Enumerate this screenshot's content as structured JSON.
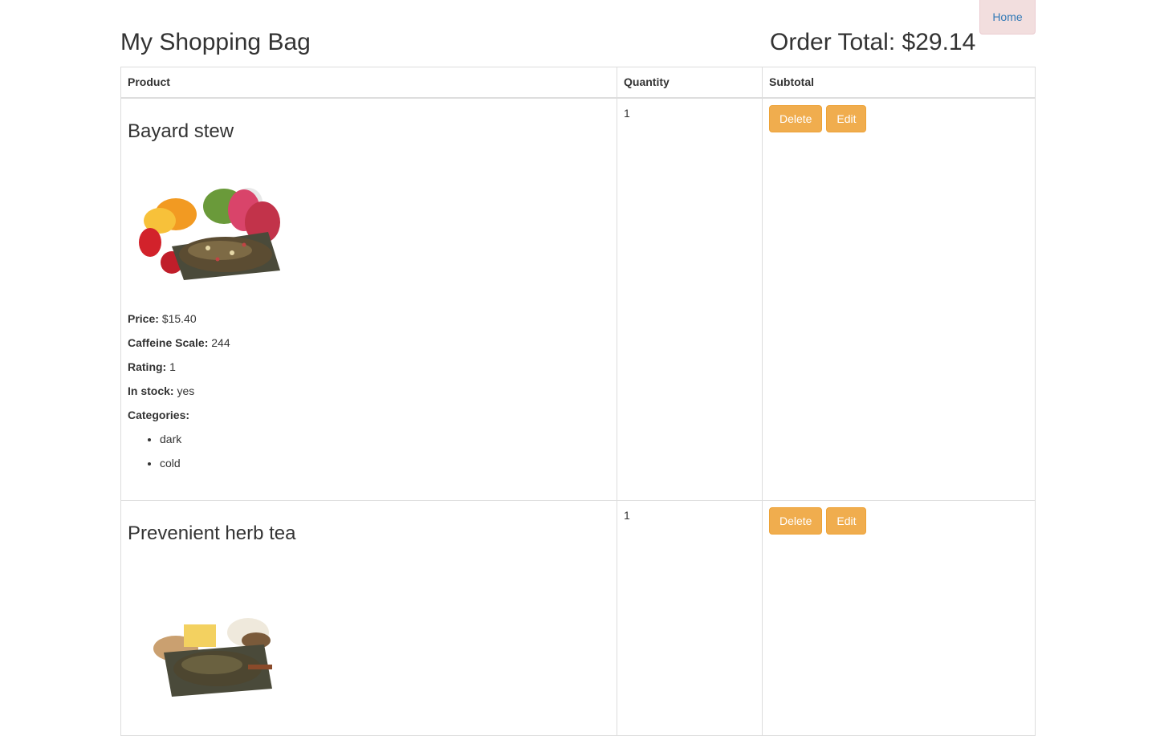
{
  "nav": {
    "home_label": "Home"
  },
  "header": {
    "title": "My Shopping Bag",
    "order_total": "Order Total: $29.14"
  },
  "table": {
    "columns": [
      "Product",
      "Quantity",
      "Subtotal"
    ],
    "labels": {
      "price": "Price:",
      "caffeine": "Caffeine Scale:",
      "rating": "Rating:",
      "in_stock": "In stock:",
      "categories": "Categories:"
    },
    "actions": {
      "delete": "Delete",
      "edit": "Edit"
    },
    "rows": [
      {
        "name": "Bayard stew",
        "image": "fruit-tea-image",
        "price": "$15.40",
        "caffeine": "244",
        "rating": "1",
        "in_stock": "yes",
        "categories": [
          "dark",
          "cold"
        ],
        "quantity": "1"
      },
      {
        "name": "Prevenient herb tea",
        "image": "herb-tea-image",
        "quantity": "1"
      }
    ]
  },
  "colors": {
    "button": "#f0ad4e",
    "home_bg": "#f2dede",
    "link": "#337ab7"
  }
}
